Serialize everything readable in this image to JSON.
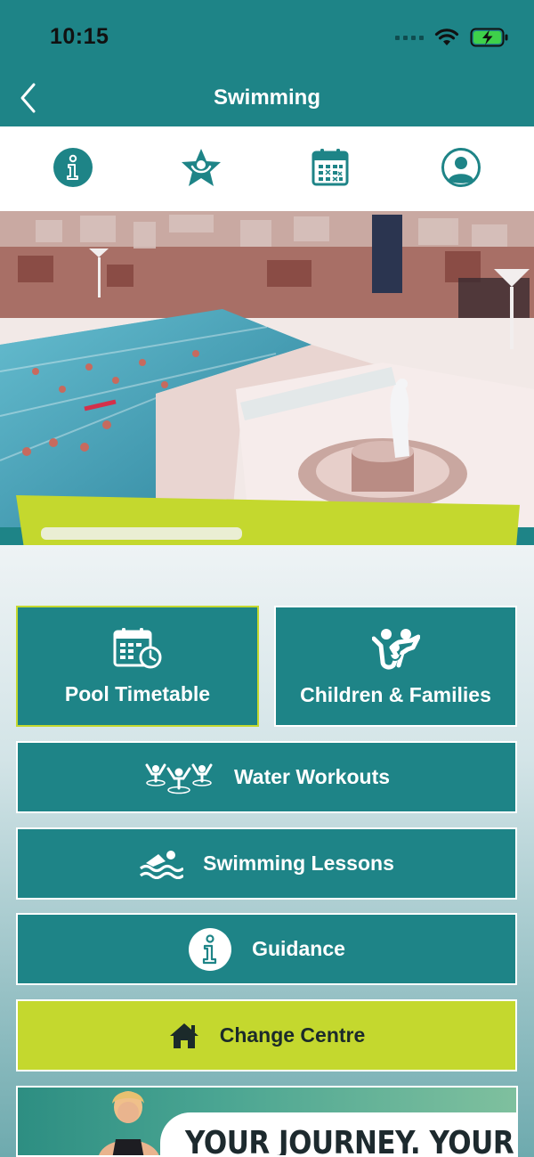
{
  "status_bar": {
    "time": "10:15"
  },
  "nav": {
    "title": "Swimming",
    "back_icon": "chevron-left-icon"
  },
  "tabs": [
    {
      "icon": "info-icon"
    },
    {
      "icon": "star-person-icon"
    },
    {
      "icon": "calendar-icon"
    },
    {
      "icon": "user-profile-icon"
    }
  ],
  "hero": {
    "image": "indoor-swimming-pool-photo"
  },
  "menu": {
    "pool_timetable": "Pool Timetable",
    "children_families": "Children & Families",
    "water_workouts": "Water Workouts",
    "swimming_lessons": "Swimming Lessons",
    "guidance": "Guidance",
    "change_centre": "Change Centre"
  },
  "promo": {
    "headline": "YOUR JOURNEY. YOUR PACE."
  },
  "colors": {
    "brand_teal": "#1e8487",
    "accent_lime": "#c4d82e",
    "white": "#ffffff"
  }
}
